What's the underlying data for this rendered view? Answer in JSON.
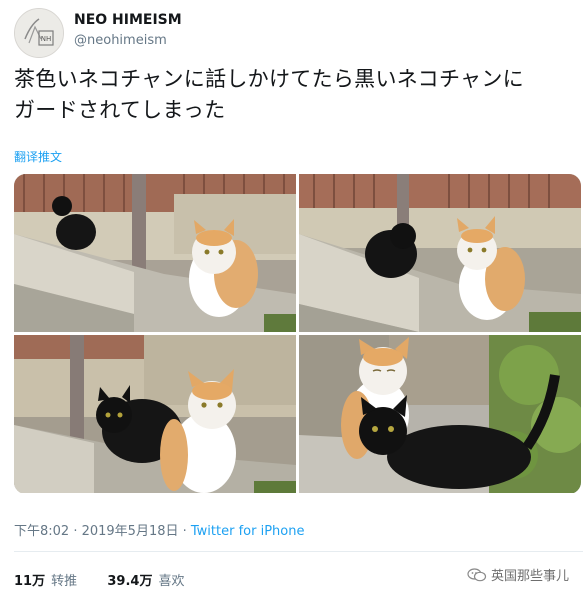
{
  "author": {
    "name": "NEO HIMEISM",
    "handle": "@neohimeism"
  },
  "tweet": {
    "line1": "茶色いネコチャンに話しかけてたら黒いネコチャンに",
    "line2": "ガードされてしまった",
    "translate_label": "翻译推文"
  },
  "meta": {
    "timestamp": "下午8:02 · 2019年5月18日 · ",
    "source": "Twitter for iPhone"
  },
  "stats": {
    "retweets_count": "11万",
    "retweets_label": "转推",
    "likes_count": "39.4万",
    "likes_label": "喜欢"
  },
  "watermark": {
    "text": "英国那些事儿"
  },
  "icons": [
    "avatar-logo",
    "wechat-icon"
  ]
}
